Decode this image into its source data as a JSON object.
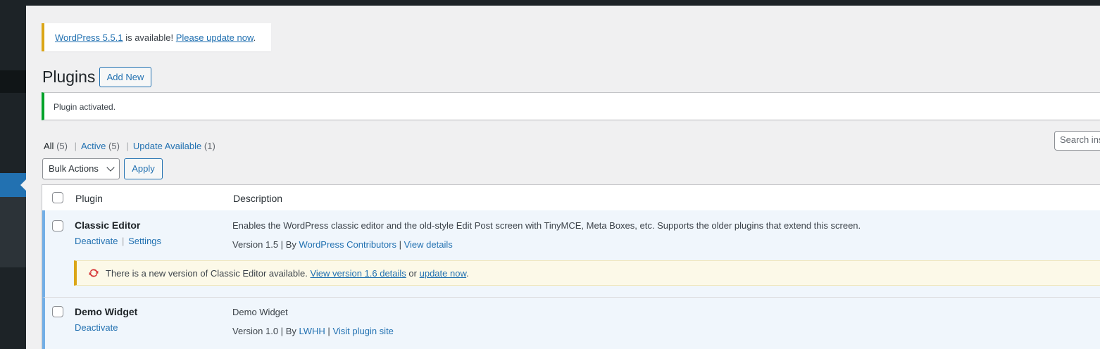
{
  "notice_update": {
    "wp_link": "WordPress 5.5.1",
    "text_mid": " is available! ",
    "update_link": "Please update now",
    "text_end": "."
  },
  "header": {
    "title": "Plugins",
    "add_new": "Add New"
  },
  "activated_notice": "Plugin activated.",
  "filters": {
    "all_label": "All",
    "all_count": "(5)",
    "active_label": "Active",
    "active_count": "(5)",
    "update_label": "Update Available",
    "update_count": "(1)",
    "separator": "|"
  },
  "search": {
    "placeholder": "Search installed plugins..."
  },
  "bulk": {
    "selected": "Bulk Actions",
    "apply": "Apply"
  },
  "table": {
    "col_plugin": "Plugin",
    "col_description": "Description",
    "rows": [
      {
        "name": "Classic Editor",
        "actions": [
          "Deactivate",
          "Settings"
        ],
        "description": "Enables the WordPress classic editor and the old-style Edit Post screen with TinyMCE, Meta Boxes, etc. Supports the older plugins that extend this screen.",
        "version": "Version 1.5",
        "by": "By",
        "author": "WordPress Contributors",
        "detail_link": "View details",
        "update_notice": {
          "text": "There is a new version of Classic Editor available. ",
          "view_link": "View version 1.6 details",
          "or": " or ",
          "update_link": "update now",
          "end": "."
        }
      },
      {
        "name": "Demo Widget",
        "actions": [
          "Deactivate"
        ],
        "description": "Demo Widget",
        "version": "Version 1.0",
        "by": "By",
        "author": "LWHH",
        "detail_link": "Visit plugin site"
      }
    ]
  },
  "colors": {
    "accent": "#2271b1",
    "warning": "#dba617",
    "success": "#00a32a",
    "update_icon": "#d63638"
  }
}
